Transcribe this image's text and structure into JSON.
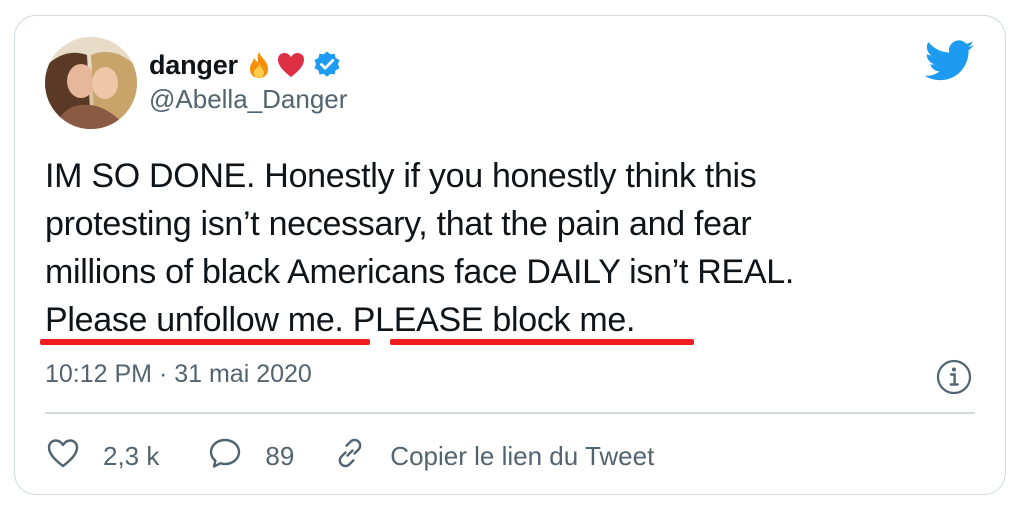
{
  "author": {
    "display_name": "danger",
    "handle": "@Abella_Danger",
    "emojis": [
      "fire-icon",
      "heart-icon"
    ],
    "verified": true
  },
  "tweet": {
    "lines": [
      "IM SO DONE. Honestly if you honestly think this",
      "protesting isn’t necessary, that the pain and fear",
      "millions of black Americans face DAILY isn’t REAL.",
      "Please unfollow me. PLEASE block me."
    ],
    "timestamp": "10:12 PM · 31 mai 2020"
  },
  "actions": {
    "like_count": "2,3 k",
    "reply_count": "89",
    "copy_link_label": "Copier le lien du Tweet"
  },
  "colors": {
    "text": "#0f1419",
    "secondary": "#536471",
    "twitter_blue": "#1d9bf0",
    "annotation_red": "#ee1c1c",
    "border": "#cfd9de"
  }
}
